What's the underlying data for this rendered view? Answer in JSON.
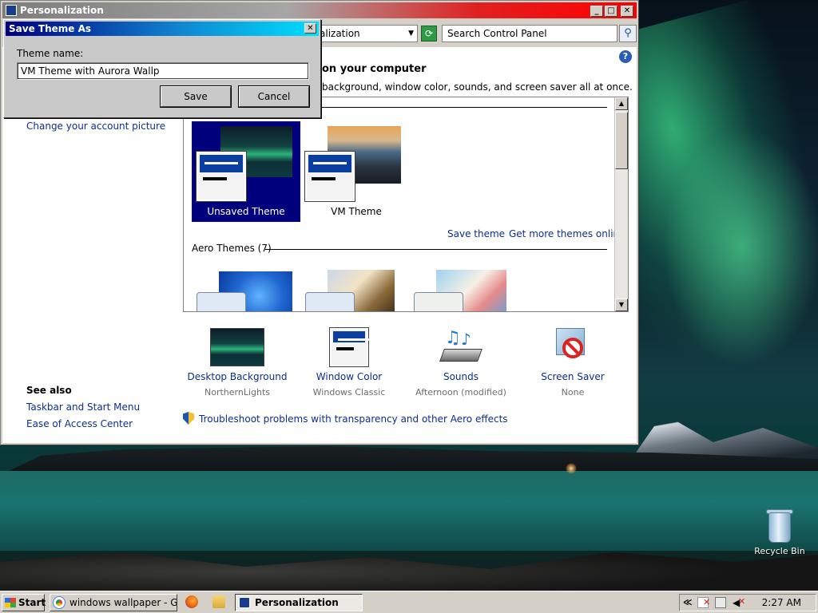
{
  "window": {
    "title": "Personalization",
    "minimize": "_",
    "maximize": "□",
    "close": "✕"
  },
  "addressbar": {
    "crumb": "alization",
    "search_placeholder": "Search Control Panel"
  },
  "content": {
    "heading": "on your computer",
    "subheading": "background, window color, sounds, and screen saver all at once.",
    "help_glyph": "?"
  },
  "sidebar": {
    "links": [
      "Change your account picture"
    ],
    "see_also_title": "See also",
    "see_also": [
      "Taskbar and Start Menu",
      "Ease of Access Center"
    ]
  },
  "themes": {
    "my_themes": [
      {
        "name": "Unsaved Theme",
        "selected": true
      },
      {
        "name": "VM Theme",
        "selected": false
      }
    ],
    "save_theme": "Save theme",
    "get_more": "Get more themes online",
    "aero_title": "Aero Themes (7)"
  },
  "options": [
    {
      "label": "Desktop Background",
      "value": "NorthernLights",
      "icon": "desktop-background-icon"
    },
    {
      "label": "Window Color",
      "value": "Windows Classic",
      "icon": "window-color-icon"
    },
    {
      "label": "Sounds",
      "value": "Afternoon (modified)",
      "icon": "sounds-icon"
    },
    {
      "label": "Screen Saver",
      "value": "None",
      "icon": "screen-saver-icon"
    }
  ],
  "troubleshoot": "Troubleshoot problems with transparency and other Aero effects",
  "dialog": {
    "title": "Save Theme As",
    "close": "✕",
    "label": "Theme name:",
    "value": "VM Theme with Aurora Wallp",
    "save": "Save",
    "cancel": "Cancel"
  },
  "desktop": {
    "recycle_bin": "Recycle Bin"
  },
  "taskbar": {
    "start": "Start",
    "tasks": [
      {
        "label": "windows wallpaper - Goo...",
        "active": false
      },
      {
        "label": "Personalization",
        "active": true
      }
    ],
    "tray_expand": "≪",
    "clock": "2:27 AM"
  },
  "colors": {
    "selection": "#00007d",
    "link": "#0b2f8f",
    "dialog_title_start": "#000080",
    "dialog_title_end": "#00e0ff"
  }
}
